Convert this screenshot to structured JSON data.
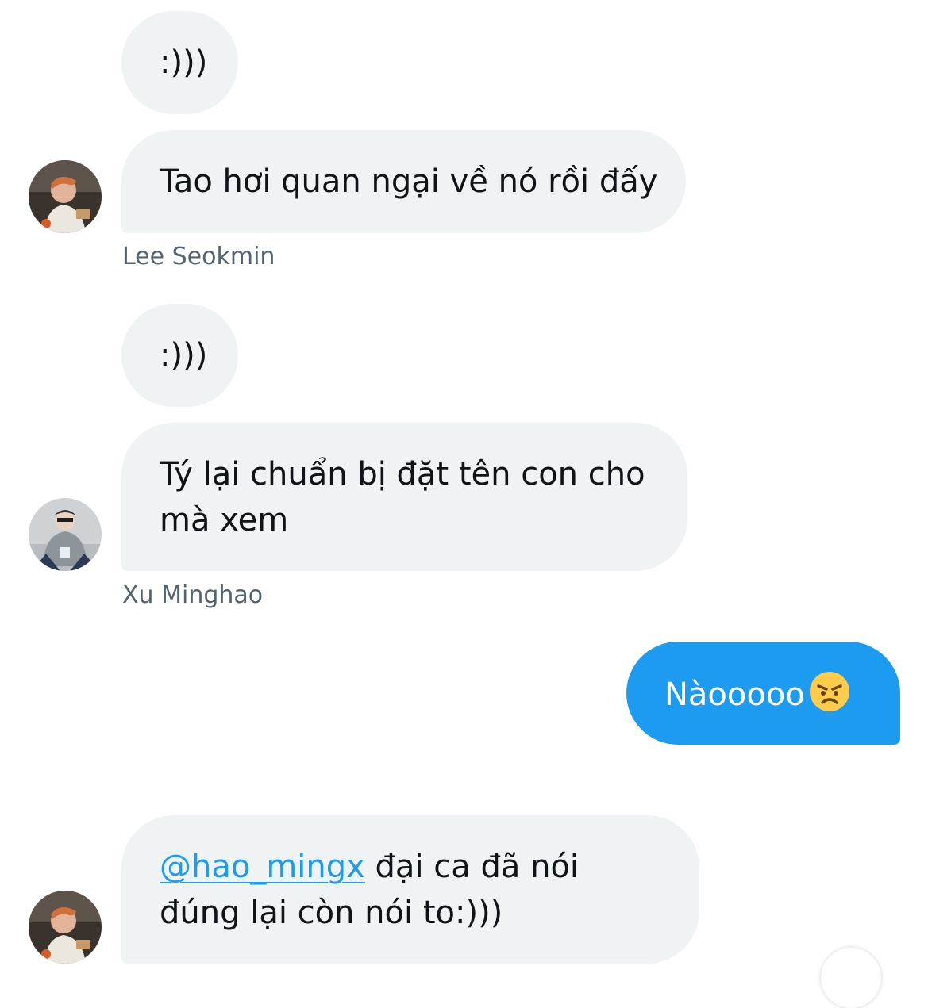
{
  "conversation": {
    "messages": [
      {
        "text": ":)))"
      },
      {
        "text": "Tao hơi quan ngại về nó rồi đấy",
        "sender": "Lee Seokmin"
      },
      {
        "text": ":)))"
      },
      {
        "text": "Tý lại chuẩn bị đặt tên con cho mà xem",
        "sender": "Xu Minghao"
      },
      {
        "text": "Nàooooo",
        "emoji": "angry-face-emoji"
      },
      {
        "mention": "@hao_mingx",
        "text": " đại ca đã nói đúng lại còn nói to:)))"
      }
    ]
  },
  "colors": {
    "incoming_bubble": "#eff3f4",
    "outgoing_bubble": "#1d9bf0",
    "mention": "#1d9bf0",
    "sender_name": "#536471"
  }
}
